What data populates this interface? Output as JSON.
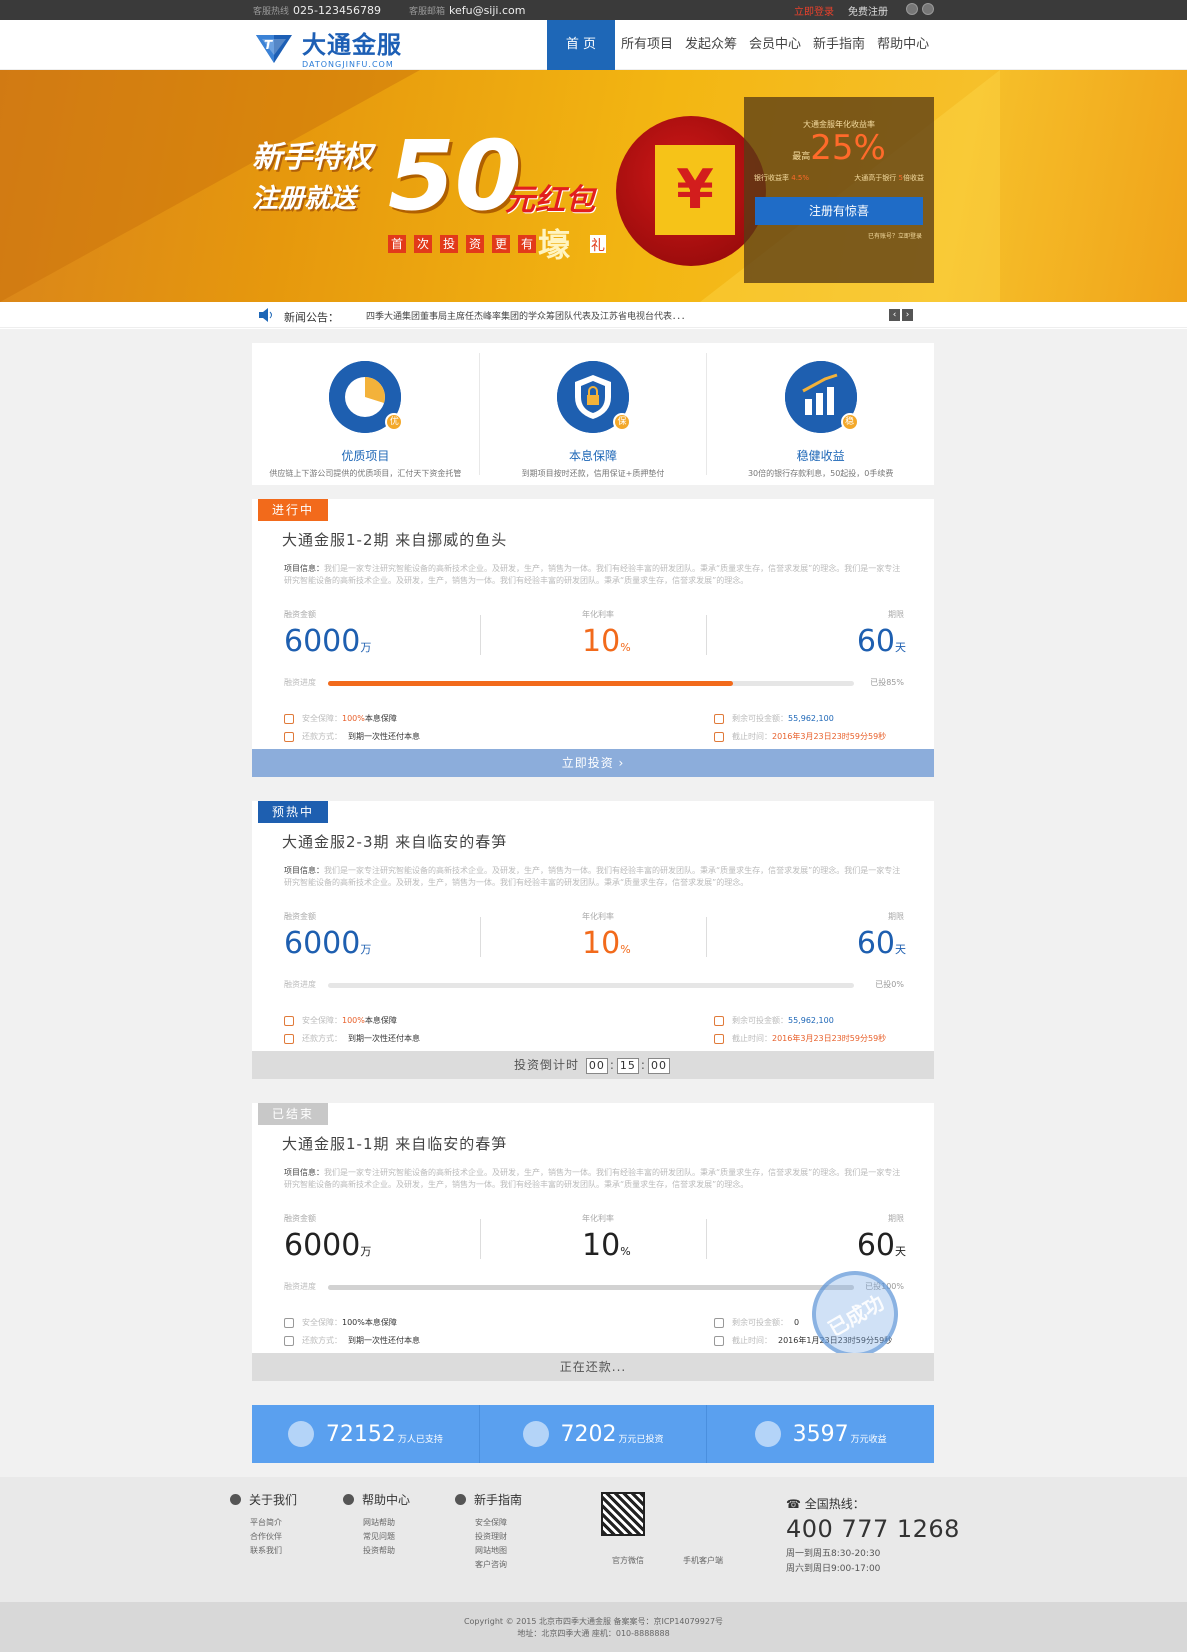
{
  "topbar": {
    "hotline_label": "客服热线",
    "hotline": "025-123456789",
    "email_label": "客服邮箱",
    "email": "kefu@siji.com",
    "login": "立即登录",
    "register": "免费注册"
  },
  "nav": {
    "logo_cn": "大通金服",
    "logo_en": "DATONGJINFU.COM",
    "items": [
      "首 页",
      "所有项目",
      "发起众筹",
      "会员中心",
      "新手指南",
      "帮助中心"
    ]
  },
  "banner": {
    "line1": "新手特权",
    "line2": "注册就送",
    "amount": "50",
    "unit": "元红包",
    "chars": [
      "首",
      "次",
      "投",
      "资",
      "更",
      "有"
    ],
    "yuan": "壕",
    "li": "礼",
    "yen": "¥",
    "panel_title": "大通金服年化收益率",
    "panel_max": "最高",
    "panel_rate": "25%",
    "panel_bank": "银行收益率",
    "panel_bank_val": "4.5%",
    "panel_compare": "大通高于银行",
    "panel_compare_val": "5",
    "panel_compare_unit": "倍收益",
    "panel_btn": "注册有惊喜",
    "panel_foot": "已有账号？立即登录"
  },
  "news": {
    "label": "新闻公告：",
    "text": "四季大通集团董事局主席任杰峰率集团的学众筹团队代表及江苏省电视台代表．．．"
  },
  "features": [
    {
      "badge": "优",
      "title": "优质项目",
      "desc": "供应链上下游公司提供的优质项目，汇付天下资金托管"
    },
    {
      "badge": "保",
      "title": "本息保障",
      "desc": "到期项目按时还款，信用保证+质押垫付"
    },
    {
      "badge": "稳",
      "title": "稳健收益",
      "desc": "30倍的银行存款利息，50起投，0手续费"
    }
  ],
  "projects": [
    {
      "tag": "进行中",
      "tag_color": "#f26a1b",
      "title": "大通金服1-2期  来自挪威的鱼头",
      "info_label": "项目信息：",
      "info": "我们是一家专注研究智能设备的高新技术企业。及研发，生产，销售为一体。我们有经验丰富的研发团队。秉承“质量求生存，信誉求发展”的理念。我们是一家专注研究智能设备的高新技术企业。及研发，生产，销售为一体。我们有经验丰富的研发团队。秉承“质量求生存，信誉求发展”的理念。",
      "amount_label": "融资金额",
      "amount": "6000",
      "amount_unit": "万",
      "rate_label": "年化利率",
      "rate": "10",
      "rate_unit": "%",
      "term_label": "期限",
      "term": "60",
      "term_unit": "天",
      "progress_label": "融资进度",
      "progress": 0.77,
      "progress_text": "已投85%",
      "safety_label": "安全保障：",
      "safety_pct": "100%",
      "safety_text": "本息保障",
      "repay_label": "还款方式：",
      "repay": "到期一次性还付本息",
      "remain_label": "剩余可投金额：",
      "remain": "55,962,100",
      "deadline_label": "截止时间：",
      "deadline": "2016年3月23日23时59分59秒",
      "action": "立即投资  ›"
    },
    {
      "tag": "预热中",
      "tag_color": "#1e5fb0",
      "title": "大通金服2-3期  来自临安的春笋",
      "info_label": "项目信息：",
      "info": "我们是一家专注研究智能设备的高新技术企业。及研发，生产，销售为一体。我们有经验丰富的研发团队。秉承“质量求生存，信誉求发展”的理念。我们是一家专注研究智能设备的高新技术企业。及研发，生产，销售为一体。我们有经验丰富的研发团队。秉承“质量求生存，信誉求发展”的理念。",
      "amount_label": "融资金额",
      "amount": "6000",
      "amount_unit": "万",
      "rate_label": "年化利率",
      "rate": "10",
      "rate_unit": "%",
      "term_label": "期限",
      "term": "60",
      "term_unit": "天",
      "progress_label": "融资进度",
      "progress": 0,
      "progress_text": "已投0%",
      "safety_label": "安全保障：",
      "safety_pct": "100%",
      "safety_text": "本息保障",
      "repay_label": "还款方式：",
      "repay": "到期一次性还付本息",
      "remain_label": "剩余可投金额：",
      "remain": "55,962,100",
      "deadline_label": "截止时间：",
      "deadline": "2016年3月23日23时59分59秒",
      "countdown_label": "投资倒计时",
      "countdown": [
        "00",
        "15",
        "00"
      ]
    },
    {
      "tag": "已结束",
      "tag_color": "#c8c8c8",
      "title": "大通金服1-1期  来自临安的春笋",
      "info_label": "项目信息：",
      "info": "我们是一家专注研究智能设备的高新技术企业。及研发，生产，销售为一体。我们有经验丰富的研发团队。秉承“质量求生存，信誉求发展”的理念。我们是一家专注研究智能设备的高新技术企业。及研发，生产，销售为一体。我们有经验丰富的研发团队。秉承“质量求生存，信誉求发展”的理念。",
      "amount_label": "融资金额",
      "amount": "6000",
      "amount_unit": "万",
      "rate_label": "年化利率",
      "rate": "10",
      "rate_unit": "%",
      "term_label": "期限",
      "term": "60",
      "term_unit": "天",
      "progress_label": "融资进度",
      "progress": 1,
      "progress_text": "已投100%",
      "safety_label": "安全保障：",
      "safety_pct": "100%",
      "safety_text": "本息保障",
      "repay_label": "还款方式：",
      "repay": "到期一次性还付本息",
      "remain_label": "剩余可投金额：",
      "remain": "0",
      "deadline_label": "截止时间：",
      "deadline": "2016年1月23日23时59分59秒",
      "stamp": "已成功",
      "action": "正在还款..."
    }
  ],
  "stats": [
    {
      "value": "72152",
      "unit": "万人已支持"
    },
    {
      "value": "7202",
      "unit": "万元已投资"
    },
    {
      "value": "3597",
      "unit": "万元收益"
    }
  ],
  "footer": {
    "about": {
      "title": "关于我们",
      "links": [
        "平台简介",
        "合作伙伴",
        "联系我们"
      ]
    },
    "help": {
      "title": "帮助中心",
      "links": [
        "网站帮助",
        "常见问题",
        "投资帮助"
      ]
    },
    "guide": {
      "title": "新手指南",
      "links": [
        "安全保障",
        "投资理财",
        "网站地图",
        "客户咨询"
      ]
    },
    "wechat": "官方微信",
    "app": "手机客户端",
    "hotline_title": "全国热线：",
    "phone": "400 777 1268",
    "hours1": "周一到周五8:30-20:30",
    "hours2": "周六到周日9:00-17:00"
  },
  "copyright": {
    "line1": "Copyright © 2015 北京市四季大通金服  备案案号：京ICP14079927号",
    "line2": "地址：北京四季大通 座机：010-8888888"
  }
}
